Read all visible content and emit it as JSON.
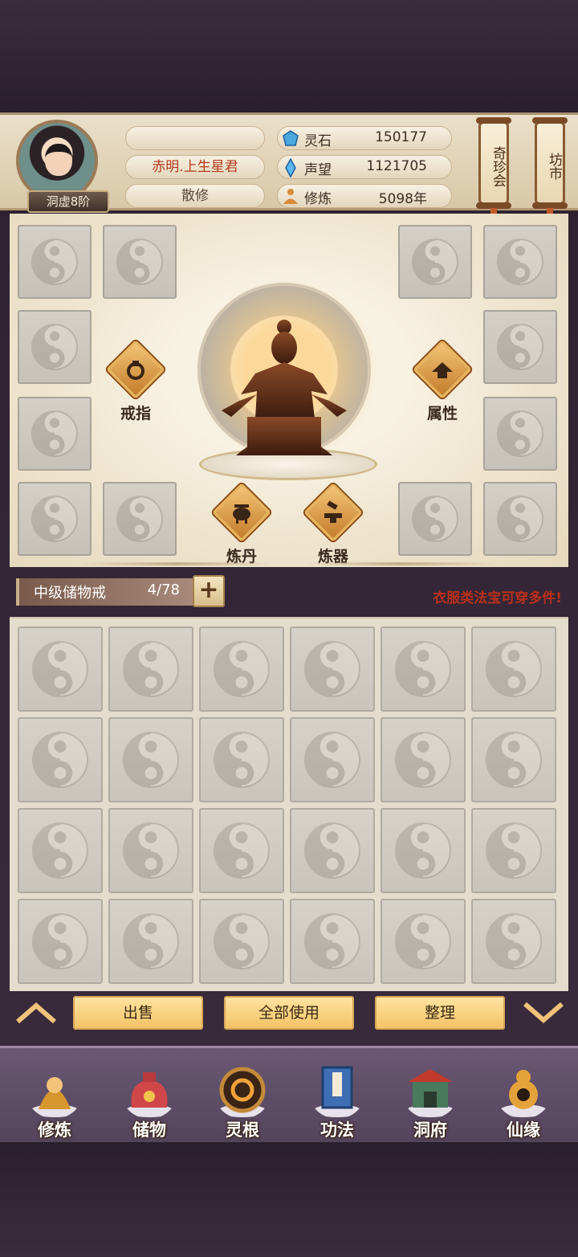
{
  "header": {
    "rank_label": "洞虚8阶",
    "name_empty": "",
    "title": "赤明.上生星君",
    "sect": "散修",
    "stats": [
      {
        "label": "灵石",
        "value": "150177",
        "icon": "spirit-stone-icon"
      },
      {
        "label": "声望",
        "value": "1121705",
        "icon": "reputation-crystal-icon"
      },
      {
        "label": "修炼",
        "value": "5098年",
        "icon": "meditation-icon"
      }
    ],
    "buttons": {
      "treasure_fair": "奇珍会",
      "market": "坊市"
    }
  },
  "equip": {
    "ring_label": "戒指",
    "attr_label": "属性",
    "alchemy_label": "炼丹",
    "forge_label": "炼器"
  },
  "storage": {
    "name": "中级储物戒",
    "count": "4/78",
    "add_label": "+",
    "hint": "衣服类法宝可穿多件!"
  },
  "actions": {
    "sell": "出售",
    "use_all": "全部使用",
    "sort": "整理"
  },
  "nav": [
    {
      "label": "修炼",
      "icon": "cultivation-icon"
    },
    {
      "label": "储物",
      "icon": "storage-bag-icon"
    },
    {
      "label": "灵根",
      "icon": "spirit-root-icon"
    },
    {
      "label": "功法",
      "icon": "technique-book-icon"
    },
    {
      "label": "洞府",
      "icon": "cave-abode-icon"
    },
    {
      "label": "仙缘",
      "icon": "immortal-fate-icon"
    }
  ],
  "colors": {
    "accent": "#f3c366",
    "hint_red": "#b8301b",
    "nav_bg": "#6a5874"
  }
}
